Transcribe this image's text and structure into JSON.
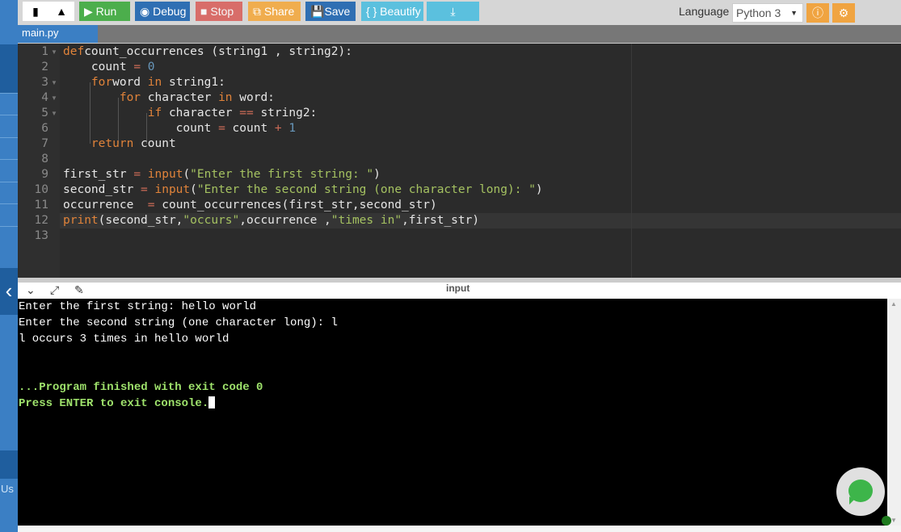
{
  "toolbar": {
    "run": "Run",
    "debug": "Debug",
    "stop": "Stop",
    "share": "Share",
    "save": "Save",
    "beautify": "{ } Beautify",
    "language_label": "Language",
    "language_value": "Python 3"
  },
  "file_tab": "main.py",
  "sidebar": {
    "partial_label": "Us"
  },
  "code": [
    [
      [
        "k",
        "def"
      ],
      [
        "",
        "count_occurrences (string1 , string2):"
      ]
    ],
    [
      [
        "",
        "    count "
      ],
      [
        "o",
        "="
      ],
      [
        "n",
        " 0"
      ]
    ],
    [
      [
        "k",
        "    for"
      ],
      [
        "",
        "word "
      ],
      [
        "k",
        "in"
      ],
      [
        "",
        " string1:"
      ]
    ],
    [
      [
        "k",
        "        for"
      ],
      [
        "",
        " character "
      ],
      [
        "k",
        "in"
      ],
      [
        "",
        " word:"
      ]
    ],
    [
      [
        "k",
        "            if"
      ],
      [
        "",
        " character "
      ],
      [
        "o",
        "=="
      ],
      [
        "",
        " string2:"
      ]
    ],
    [
      [
        "",
        "                count "
      ],
      [
        "o",
        "="
      ],
      [
        "",
        " count "
      ],
      [
        "o",
        "+"
      ],
      [
        "n",
        " 1"
      ]
    ],
    [
      [
        "k",
        "    return"
      ],
      [
        "",
        " count"
      ]
    ],
    [],
    [
      [
        "",
        "first_str "
      ],
      [
        "o",
        "="
      ],
      [
        "f",
        " input"
      ],
      [
        "",
        "("
      ],
      [
        "s",
        "\"Enter the first string: \""
      ],
      [
        "",
        ")"
      ]
    ],
    [
      [
        "",
        "second_str "
      ],
      [
        "o",
        "="
      ],
      [
        "f",
        " input"
      ],
      [
        "",
        "("
      ],
      [
        "s",
        "\"Enter the second string (one character long): \""
      ],
      [
        "",
        ")"
      ]
    ],
    [
      [
        "",
        "occurrence  "
      ],
      [
        "o",
        "="
      ],
      [
        "",
        " count_occurrences(first_str,second_str)"
      ]
    ],
    [
      [
        "f",
        "print"
      ],
      [
        "",
        "(second_str,"
      ],
      [
        "s",
        "\"occurs\""
      ],
      [
        "",
        ",occurrence ,"
      ],
      [
        "s",
        "\"times in\""
      ],
      [
        "",
        ",first_str)"
      ]
    ],
    []
  ],
  "console": {
    "header": "input",
    "lines": [
      "Enter the first string: hello world",
      "Enter the second string (one character long): l",
      "l occurs 3 times in hello world",
      "",
      "",
      "...Program finished with exit code 0",
      "Press ENTER to exit console."
    ]
  },
  "colors": {
    "accent": "#3b7fc4",
    "run": "#4cae4c",
    "stop": "#d9534f",
    "share": "#f0ad4e"
  }
}
